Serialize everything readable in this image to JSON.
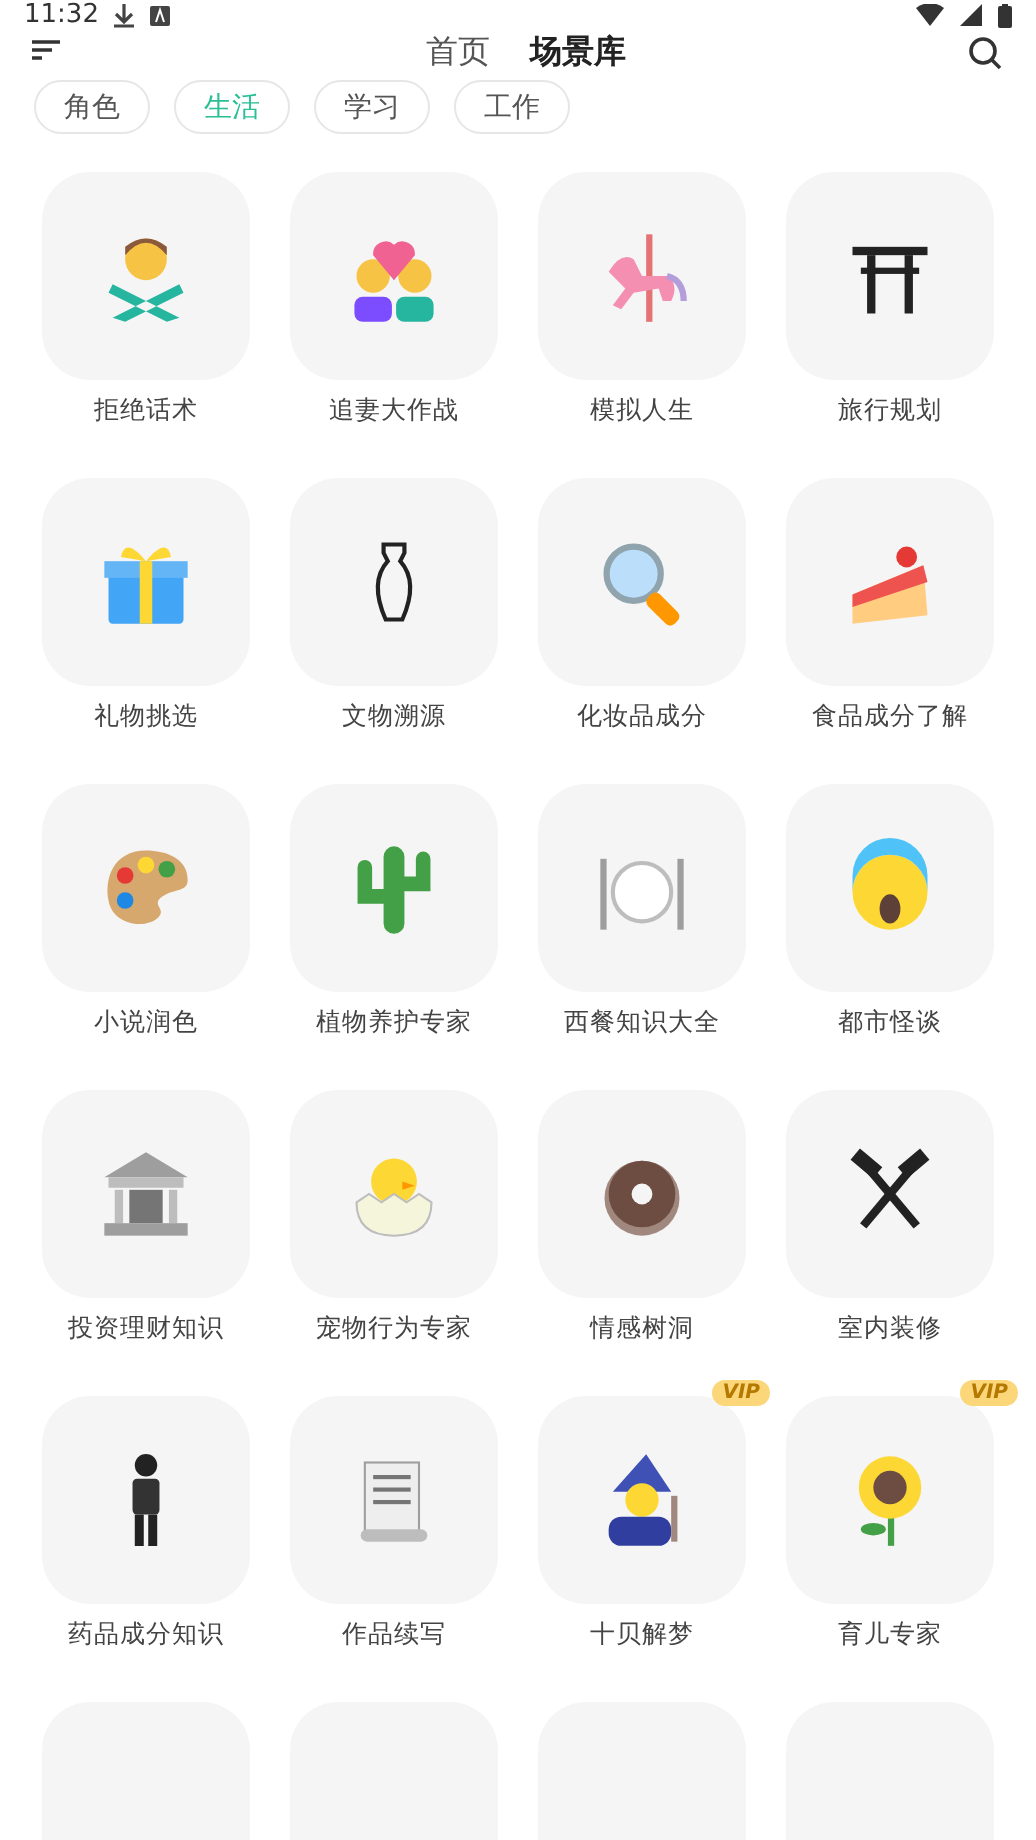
{
  "status_bar": {
    "time": "11:32"
  },
  "header": {
    "tabs": [
      {
        "label": "首页",
        "selected": false
      },
      {
        "label": "场景库",
        "selected": true
      }
    ]
  },
  "categories": [
    {
      "label": "角色",
      "selected": false
    },
    {
      "label": "生活",
      "selected": true
    },
    {
      "label": "学习",
      "selected": false
    },
    {
      "label": "工作",
      "selected": false
    }
  ],
  "scenes": [
    {
      "label": "拒绝话术",
      "vip": false
    },
    {
      "label": "追妻大作战",
      "vip": false
    },
    {
      "label": "模拟人生",
      "vip": false
    },
    {
      "label": "旅行规划",
      "vip": false
    },
    {
      "label": "礼物挑选",
      "vip": false
    },
    {
      "label": "文物溯源",
      "vip": false
    },
    {
      "label": "化妆品成分",
      "vip": false
    },
    {
      "label": "食品成分了解",
      "vip": false
    },
    {
      "label": "小说润色",
      "vip": false
    },
    {
      "label": "植物养护专家",
      "vip": false
    },
    {
      "label": "西餐知识大全",
      "vip": false
    },
    {
      "label": "都市怪谈",
      "vip": false
    },
    {
      "label": "投资理财知识",
      "vip": false
    },
    {
      "label": "宠物行为专家",
      "vip": false
    },
    {
      "label": "情感树洞",
      "vip": false
    },
    {
      "label": "室内装修",
      "vip": false
    },
    {
      "label": "药品成分知识",
      "vip": false
    },
    {
      "label": "作品续写",
      "vip": false
    },
    {
      "label": "十贝解梦",
      "vip": true,
      "badge": "VIP"
    },
    {
      "label": "育儿专家",
      "vip": true,
      "badge": "VIP"
    }
  ]
}
